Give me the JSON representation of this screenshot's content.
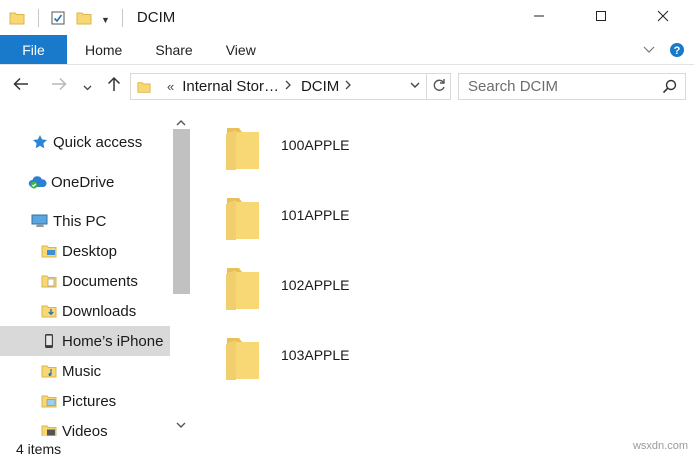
{
  "window": {
    "title": "DCIM",
    "minimize_icon": "minimize-icon",
    "maximize_icon": "maximize-icon",
    "close_icon": "close-icon"
  },
  "ribbon": {
    "tabs": [
      "File",
      "Home",
      "Share",
      "View"
    ],
    "file_color": "#1979ca"
  },
  "address": {
    "overflow": "«",
    "segments": [
      "Internal Stor…",
      "DCIM"
    ]
  },
  "search": {
    "placeholder": "Search DCIM"
  },
  "nav_pane": {
    "items": [
      {
        "label": "Quick access",
        "icon": "star-icon"
      },
      {
        "label": "OneDrive",
        "icon": "cloud-icon"
      },
      {
        "label": "This PC",
        "icon": "computer-icon"
      },
      {
        "label": "Desktop",
        "icon": "desktop-folder-icon"
      },
      {
        "label": "Documents",
        "icon": "documents-folder-icon"
      },
      {
        "label": "Downloads",
        "icon": "downloads-folder-icon"
      },
      {
        "label": "Home’s iPhone",
        "icon": "phone-icon",
        "selected": true
      },
      {
        "label": "Music",
        "icon": "music-folder-icon"
      },
      {
        "label": "Pictures",
        "icon": "pictures-folder-icon"
      },
      {
        "label": "Videos",
        "icon": "videos-folder-icon"
      }
    ]
  },
  "files": [
    {
      "name": "100APPLE",
      "type": "folder"
    },
    {
      "name": "101APPLE",
      "type": "folder"
    },
    {
      "name": "102APPLE",
      "type": "folder"
    },
    {
      "name": "103APPLE",
      "type": "folder"
    }
  ],
  "status": {
    "item_count": "4 items"
  },
  "watermark": "wsxdn.com"
}
